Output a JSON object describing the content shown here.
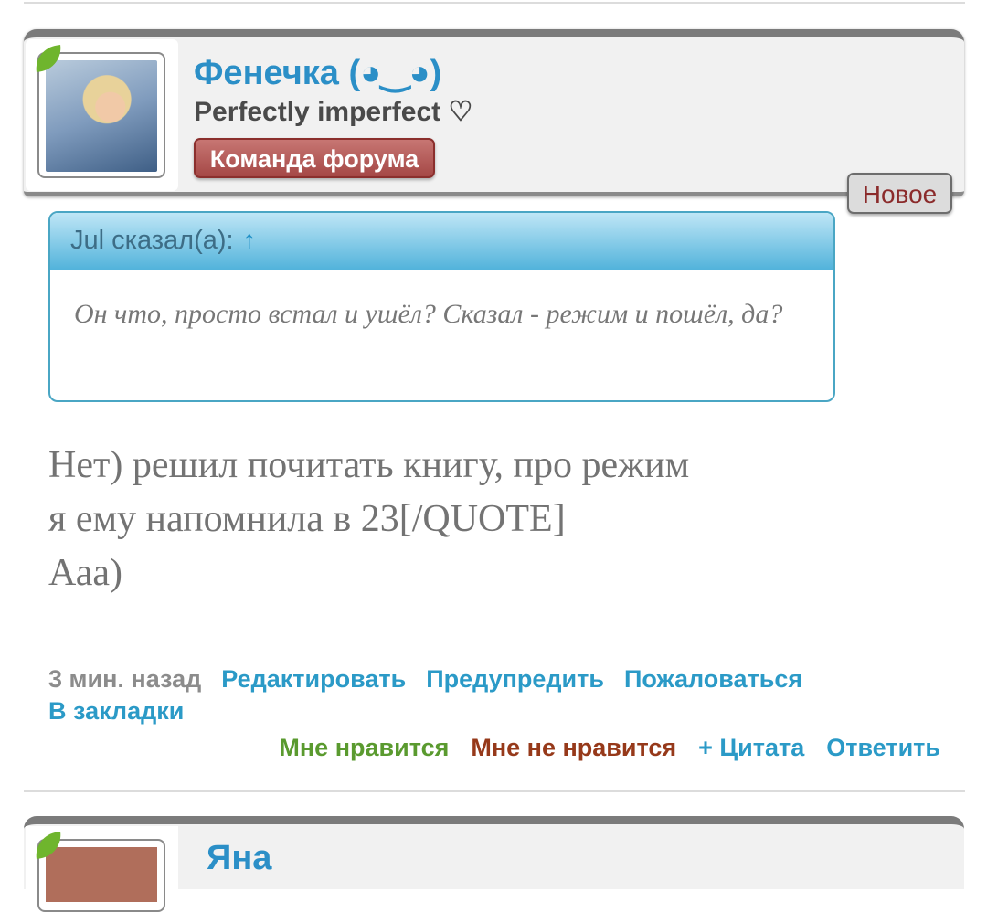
{
  "post": {
    "username": "Фенечка (◕‿◕)",
    "status": "Perfectly imperfect ♡",
    "role_badge": "Команда форума",
    "new_badge": "Новое",
    "quote": {
      "author_label": "Jul сказал(а):",
      "arrow": "↑",
      "text": "Он что, просто встал и ушёл? Сказал - режим и пошёл, да?"
    },
    "body_lines": [
      "Нет) решил почитать книгу, про режим",
      "я ему напомнила в 23[/QUOTE]",
      "Ааа)"
    ],
    "timestamp": "3 мин. назад",
    "actions_top": [
      "Редактировать",
      "Предупредить",
      "Пожаловаться"
    ],
    "bookmark": "В закладки",
    "actions_bottom": {
      "like": "Мне нравится",
      "dislike": "Мне не нравится",
      "quote": "+ Цитата",
      "reply": "Ответить"
    }
  },
  "next_post": {
    "username": "Яна"
  },
  "colors": {
    "link": "#2b9ac7",
    "username": "#2b8fc7",
    "like": "#5a9a2f",
    "dislike": "#96391a",
    "role_badge": "#a54846"
  }
}
